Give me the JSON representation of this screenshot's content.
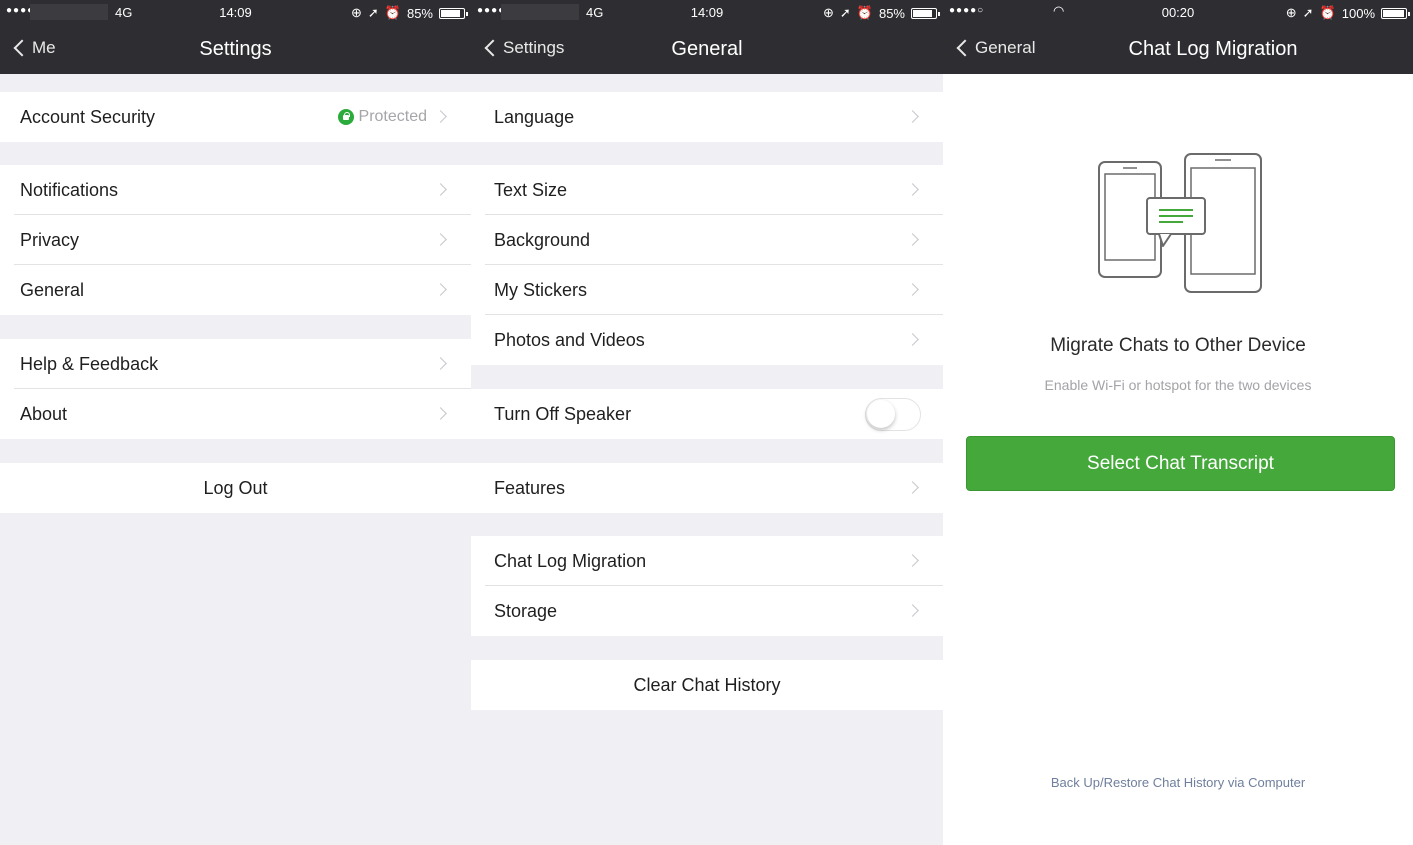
{
  "colors": {
    "nav_bg": "#2e2e32",
    "group_bg": "#efeff4",
    "cell_bg": "#ffffff",
    "accent_green": "#44a83b",
    "secure_green": "#2bab3b",
    "link_blue_gray": "#6f7f9c"
  },
  "screens": [
    {
      "status": {
        "signal": "●●●●●",
        "network": "4G",
        "time": "14:09",
        "battery": "85%",
        "battery_level": 0.85
      },
      "nav": {
        "back_label": "Me",
        "title": "Settings"
      },
      "groups": [
        [
          {
            "label": "Account Security",
            "value": "Protected",
            "value_icon": "lock-shield-icon"
          }
        ],
        [
          {
            "label": "Notifications"
          },
          {
            "label": "Privacy"
          },
          {
            "label": "General"
          }
        ],
        [
          {
            "label": "Help & Feedback"
          },
          {
            "label": "About"
          }
        ],
        [
          {
            "label": "Log Out",
            "centered": true
          }
        ]
      ]
    },
    {
      "status": {
        "signal": "●●●●●",
        "network": "4G",
        "time": "14:09",
        "battery": "85%",
        "battery_level": 0.85
      },
      "nav": {
        "back_label": "Settings",
        "title": "General"
      },
      "groups": [
        [
          {
            "label": "Language"
          }
        ],
        [
          {
            "label": "Text Size"
          },
          {
            "label": "Background"
          },
          {
            "label": "My Stickers"
          },
          {
            "label": "Photos and Videos"
          }
        ],
        [
          {
            "label": "Turn Off Speaker",
            "toggle": false
          }
        ],
        [
          {
            "label": "Features"
          }
        ],
        [
          {
            "label": "Chat Log Migration"
          },
          {
            "label": "Storage"
          }
        ],
        [
          {
            "label": "Clear Chat History",
            "centered": true
          }
        ]
      ]
    },
    {
      "status": {
        "signal": "●●●●○",
        "time": "00:20",
        "battery": "100%",
        "battery_level": 1.0
      },
      "nav": {
        "back_label": "General",
        "title": "Chat Log Migration"
      },
      "illustration": "two-phones-chat-icon",
      "heading": "Migrate Chats to Other Device",
      "subtext": "Enable Wi-Fi or hotspot for the two devices",
      "button": "Select Chat Transcript",
      "footer_link": "Back Up/Restore Chat History via Computer"
    }
  ]
}
